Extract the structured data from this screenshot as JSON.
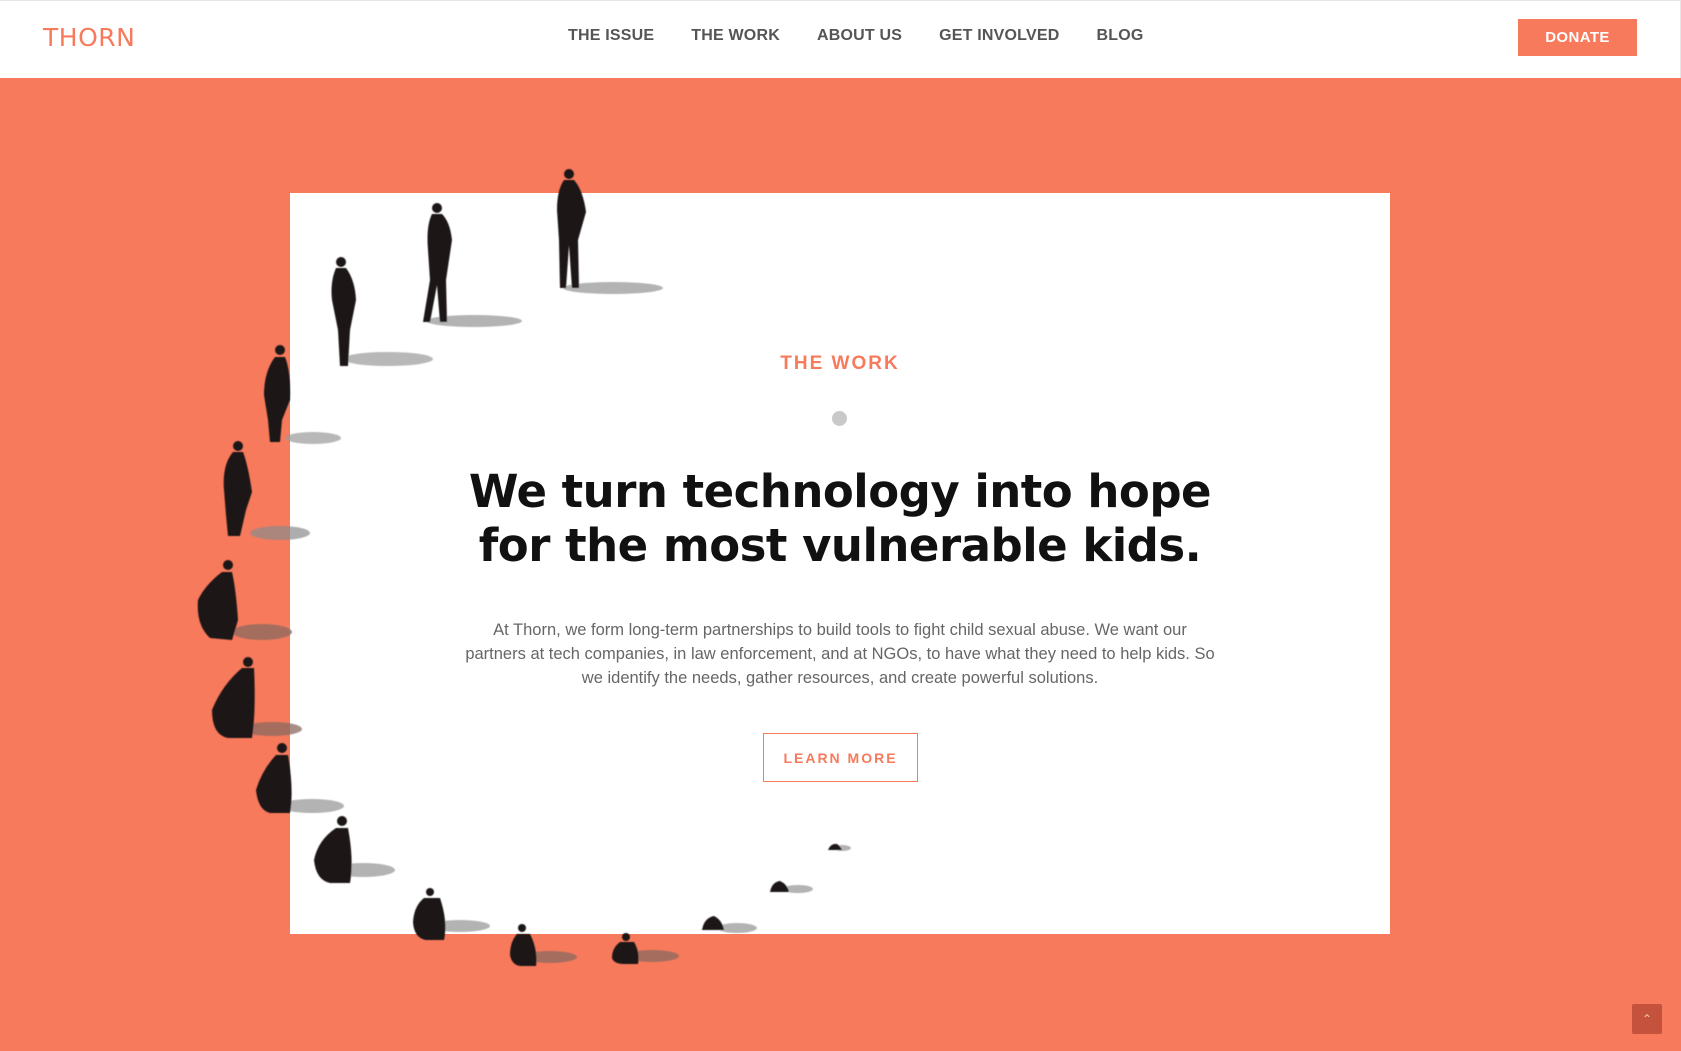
{
  "header": {
    "logo": "THORN",
    "nav": [
      {
        "label": "THE ISSUE"
      },
      {
        "label": "THE WORK"
      },
      {
        "label": "ABOUT US"
      },
      {
        "label": "GET INVOLVED"
      },
      {
        "label": "BLOG"
      }
    ],
    "donate_label": "DONATE"
  },
  "hero": {
    "eyebrow": "THE WORK",
    "headline_line1": "We turn technology into hope",
    "headline_line2": "for the most vulnerable kids.",
    "body_line1": "At Thorn, we form long-term partnerships to build tools to fight child sexual abuse. We want our",
    "body_line2": "partners at tech companies, in law enforcement, and at NGOs, to have what they need to help kids. So",
    "body_line3": "we identify the needs, gather resources, and create powerful solutions.",
    "cta_label": "LEARN MORE"
  },
  "colors": {
    "accent": "#f77a5c",
    "background": "#f77a5c",
    "card": "#ffffff",
    "heading": "#111111",
    "body": "#666666",
    "dot": "#c9c9c9"
  },
  "icons": {
    "scroll_top": "chevron-up-icon"
  }
}
